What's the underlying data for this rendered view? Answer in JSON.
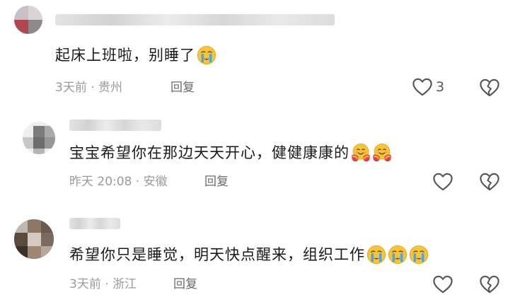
{
  "comments": [
    {
      "text": "起床上班啦，别睡了",
      "emojis": [
        "crying-face"
      ],
      "meta": "3天前 · 贵州",
      "reply_label": "回复",
      "like_count": "3"
    },
    {
      "text": "宝宝希望你在那边天天开心，健健康康的",
      "emojis": [
        "hugging-face",
        "hugging-face"
      ],
      "meta": "昨天 20:08 · 安徽",
      "reply_label": "回复",
      "like_count": ""
    },
    {
      "text": "希望你只是睡觉，明天快点醒来，组织工作",
      "emojis": [
        "crying-face",
        "crying-face",
        "crying-face"
      ],
      "meta": "3天前 · 浙江",
      "reply_label": "回复",
      "like_count": ""
    }
  ],
  "colors": {
    "text": "#1a1a1a",
    "meta": "#9a9a9a",
    "icon": "#555555",
    "emoji": "#f5c43a",
    "tear": "#4aa6e8"
  }
}
